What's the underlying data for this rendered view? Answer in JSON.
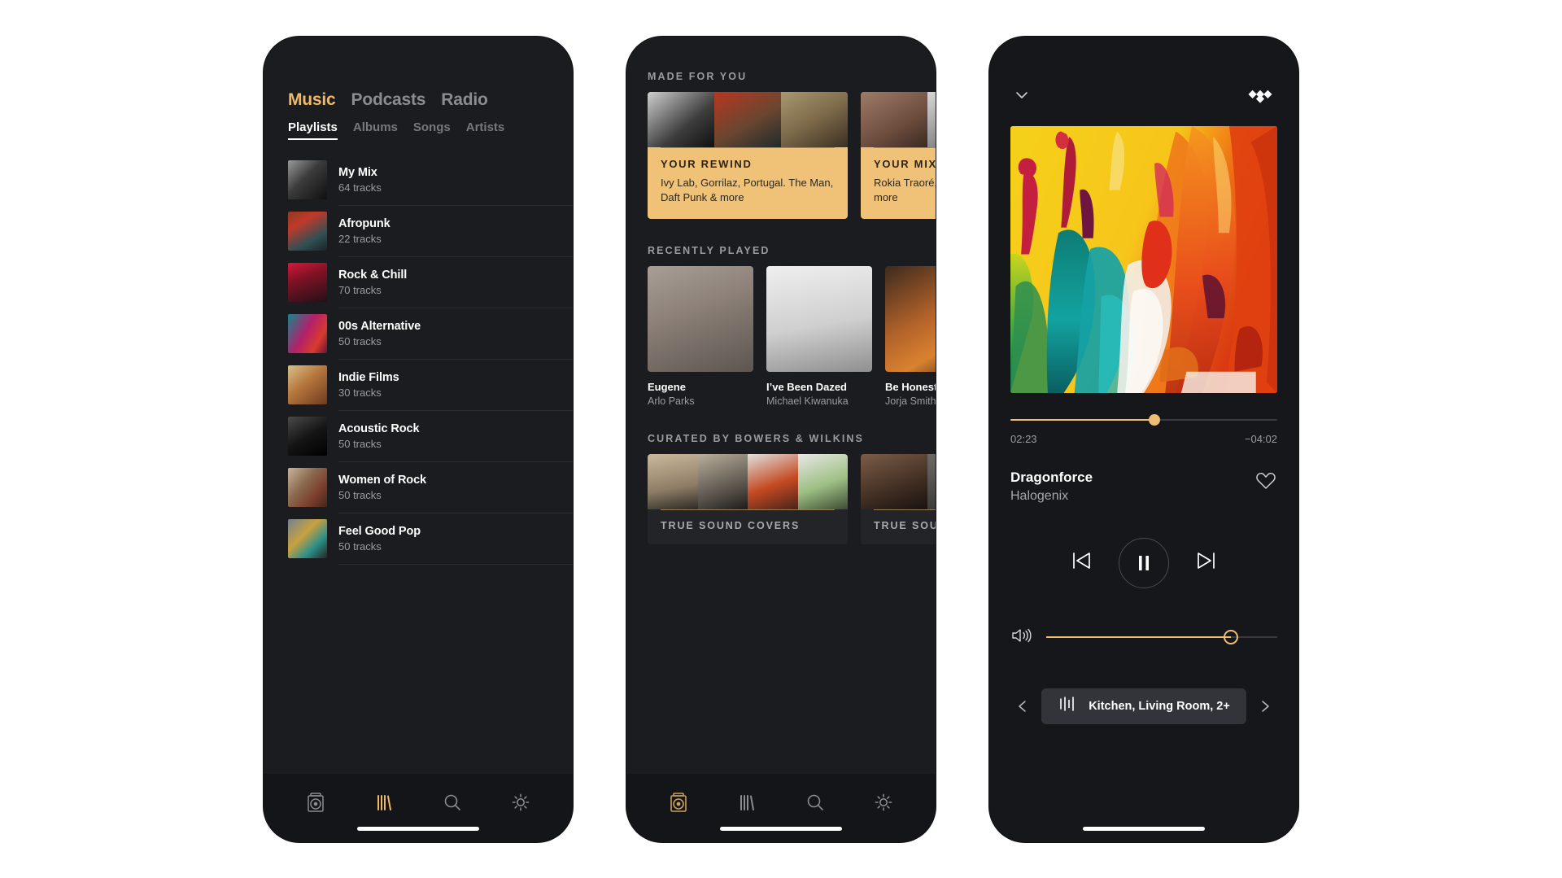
{
  "brand": {
    "accent": "#f0b963",
    "accent_soft": "#f0c278",
    "bg_dark": "#1b1c20",
    "logo": "tidal-diamonds-logo"
  },
  "library_screen": {
    "main_tabs": [
      {
        "label": "Music",
        "active": true
      },
      {
        "label": "Podcasts",
        "active": false
      },
      {
        "label": "Radio",
        "active": false
      }
    ],
    "sub_tabs": [
      {
        "label": "Playlists",
        "active": true
      },
      {
        "label": "Albums",
        "active": false
      },
      {
        "label": "Songs",
        "active": false
      },
      {
        "label": "Artists",
        "active": false
      }
    ],
    "playlists": [
      {
        "title": "My Mix",
        "tracks": "64 tracks"
      },
      {
        "title": "Afropunk",
        "tracks": "22 tracks"
      },
      {
        "title": "Rock & Chill",
        "tracks": "70 tracks"
      },
      {
        "title": "00s Alternative",
        "tracks": "50 tracks"
      },
      {
        "title": "Indie Films",
        "tracks": "30 tracks"
      },
      {
        "title": "Acoustic Rock",
        "tracks": "50 tracks"
      },
      {
        "title": "Women of Rock",
        "tracks": "50 tracks"
      },
      {
        "title": "Feel Good Pop",
        "tracks": "50 tracks"
      }
    ],
    "tab_bar": [
      {
        "icon": "speaker-icon",
        "active": false
      },
      {
        "icon": "library-icon",
        "active": true
      },
      {
        "icon": "search-icon",
        "active": false
      },
      {
        "icon": "gear-icon",
        "active": false
      }
    ]
  },
  "home_screen": {
    "sections": [
      {
        "title": "MADE FOR YOU"
      },
      {
        "title": "RECENTLY PLAYED"
      },
      {
        "title": "CURATED BY BOWERS & WILKINS"
      }
    ],
    "made_for_you": [
      {
        "kicker": "YOUR REWIND",
        "description": "Ivy Lab, Gorrilaz, Portugal. The Man, Daft Punk & more"
      },
      {
        "kicker": "YOUR MIX",
        "description": "Rokia Traoré, Susheela Raman & more"
      }
    ],
    "recently_played": [
      {
        "title": "Eugene",
        "artist": "Arlo Parks"
      },
      {
        "title": "I’ve Been Dazed",
        "artist": "Michael Kiwanuka"
      },
      {
        "title": "Be Honest",
        "artist": "Jorja Smith"
      }
    ],
    "curated": [
      {
        "kicker": "TRUE SOUND COVERS"
      },
      {
        "kicker": "TRUE SOUND"
      }
    ],
    "tab_bar": [
      {
        "icon": "speaker-icon",
        "active": true
      },
      {
        "icon": "library-icon",
        "active": false
      },
      {
        "icon": "search-icon",
        "active": false
      },
      {
        "icon": "gear-icon",
        "active": false
      }
    ]
  },
  "now_playing": {
    "collapse_icon": "chevron-down-icon",
    "logo_icon": "tidal-logo-icon",
    "album_art": "abstract-paint-artwork",
    "progress": {
      "elapsed": "02:23",
      "remaining": "−04:02",
      "percent": 54
    },
    "track": {
      "title": "Dragonforce",
      "artist": "Halogenix"
    },
    "favorite_icon": "heart-icon",
    "controls": {
      "previous": "skip-previous-icon",
      "play_pause": "pause-icon",
      "next": "skip-next-icon"
    },
    "volume": {
      "icon": "volume-icon",
      "percent": 80
    },
    "device": {
      "icon": "multiroom-speaker-icon",
      "label": "Kitchen, Living Room, 2+",
      "prev_icon": "chevron-left-icon",
      "next_icon": "chevron-right-icon"
    }
  }
}
